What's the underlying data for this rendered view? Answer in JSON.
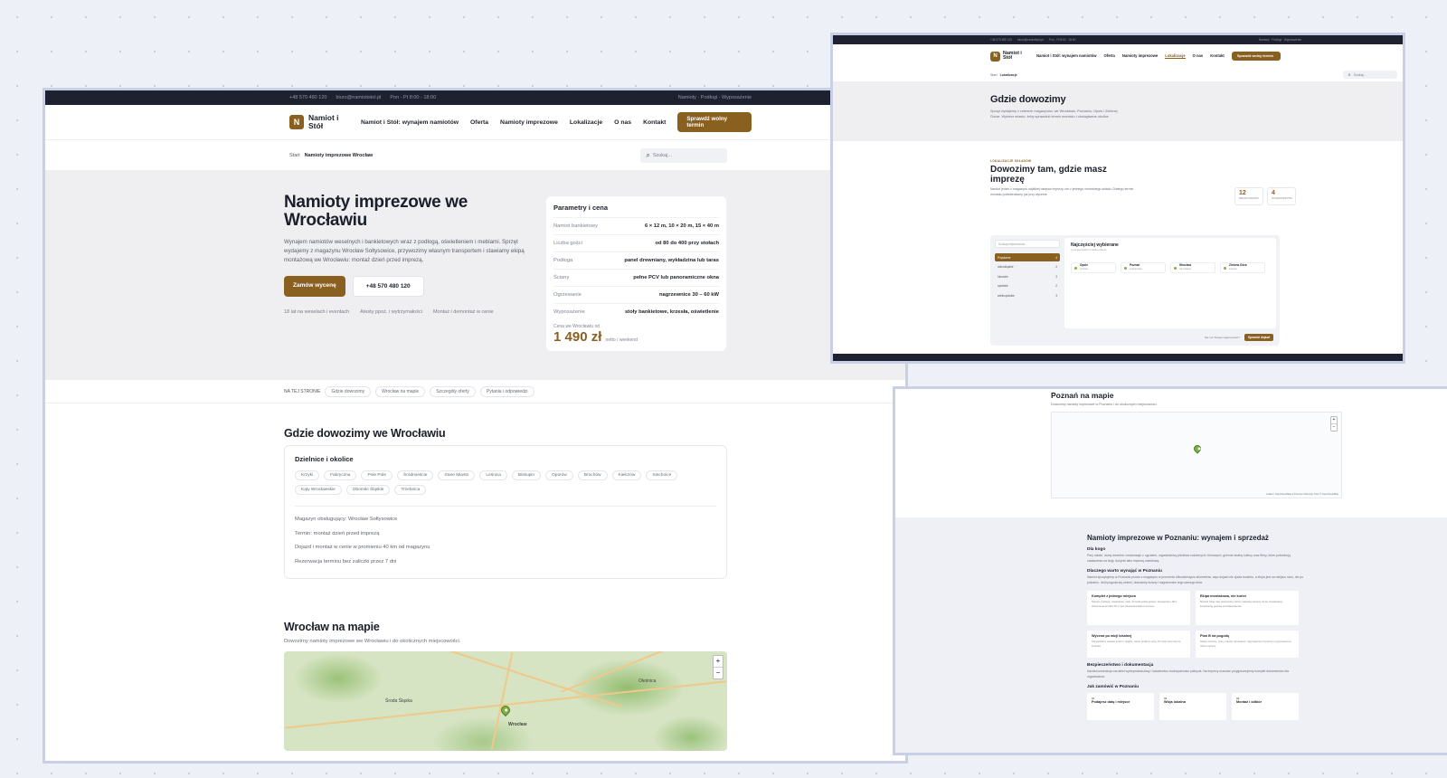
{
  "main": {
    "topbar": {
      "phone": "+48 570 480 120",
      "email": "biuro@namiotistol.pl",
      "hours": "Pon - Pt 8:00 - 18:00",
      "right": "Namioty · Podłogi · Wyposażenie"
    },
    "nav": {
      "logo_letter": "N",
      "logo_text": "Namiot i Stół",
      "links": [
        "Namiot i Stół: wynajem namiotów",
        "Oferta",
        "Namioty imprezowe",
        "Lokalizacje",
        "O nas",
        "Kontakt"
      ],
      "cta": "Sprawdź wolny termin"
    },
    "breadcrumb": {
      "root": "Start",
      "current": "Namioty imprezowe Wrocław"
    },
    "search": {
      "placeholder": "Szukaj..."
    },
    "hero": {
      "title": "Namioty imprezowe we Wrocławiu",
      "description": "Wynajem namiotów weselnych i bankietowych wraz z podłogą, oświetleniem i meblami. Sprzęt wydajemy z magazynu Wrocław Sołtysowice, przywozimy własnym transportem i stawiamy ekipą montażową we Wrocławiu: montaż dzień przed imprezą.",
      "btn_primary": "Zamów wycenę",
      "btn_phone": "+48 570 480 120",
      "features": [
        "18 lat na weselach i eventach",
        "Atesty ppoż. i wytrzymałości",
        "Montaż i demontaż w cenie"
      ]
    },
    "params": {
      "title": "Parametry i cena",
      "rows": [
        {
          "k": "Namiot bankietowy",
          "v": "6 × 12 m, 10 × 20 m, 15 × 40 m"
        },
        {
          "k": "Liczba gości",
          "v": "od 80 do 400 przy stołach"
        },
        {
          "k": "Podłoga",
          "v": "panel drewniany, wykładzina lub taras"
        },
        {
          "k": "Ściany",
          "v": "pełne PCV lub panoramiczne okna"
        },
        {
          "k": "Ogrzewanie",
          "v": "nagrzewnice 30 – 60 kW"
        },
        {
          "k": "Wyposażenie",
          "v": "stoły bankietowe, krzesła, oświetlenie"
        }
      ],
      "price_label": "Cena we Wrocławiu od",
      "price": "1 490 zł",
      "price_note": "netto / weekend"
    },
    "anchors": {
      "label": "NA TEJ STRONIE",
      "items": [
        "Gdzie dowozimy",
        "Wrocław na mapie",
        "Szczegóły oferty",
        "Pytania i odpowiedzi"
      ]
    },
    "delivery": {
      "title": "Gdzie dowozimy we Wrocławiu",
      "box_title": "Dzielnice i okolice",
      "districts": [
        "Krzyki",
        "Fabryczna",
        "Pole Pole",
        "Śródmieście",
        "Stare Miasto",
        "Leśnica",
        "Biskupin",
        "Oporów",
        "Brochów",
        "Kiełczów",
        "Siechnice",
        "Kąty Wrocławskie",
        "Oborniki Śląskie",
        "Trzebnica"
      ],
      "info": [
        "Magazyn obsługujący: Wrocław Sołtysowice",
        "Termin: montaż dzień przed imprezą",
        "Dojazd i montaż w cenie w promieniu 40 km od magazynu",
        "Rezerwacja terminu bez zaliczki przez 7 dni"
      ]
    },
    "map": {
      "title": "Wrocław na mapie",
      "subtitle": "Dowozimy namioty imprezowe we Wrocławiu i do okolicznych miejscowości.",
      "cities": [
        "Środa Śląska",
        "Wrocław",
        "Oleśnica"
      ],
      "zoom_in": "+",
      "zoom_out": "−"
    }
  },
  "locations": {
    "topbar": {
      "phone": "+48 570 480 120",
      "email": "biuro@namiotistol.pl",
      "hours": "Pon - Pt 8:00 - 18:00",
      "right": "Namioty · Podłogi · Wyposażenie"
    },
    "nav": {
      "logo_letter": "N",
      "logo_text": "Namiot i Stół",
      "links": [
        "Namiot i Stół: wynajem namiotów",
        "Oferta",
        "Namioty imprezowe",
        "Lokalizacje",
        "O nas",
        "Kontakt"
      ],
      "cta": "Sprawdź wolny termin"
    },
    "breadcrumb": {
      "root": "Start",
      "current": "Lokalizacje"
    },
    "search": {
      "placeholder": "Szukaj..."
    },
    "hero": {
      "title": "Gdzie dowozimy",
      "description": "Sprzęt wydajemy z czterech magazynów: we Wrocławiu, Poznaniu, Opolu i Zielonej Górze. Wybierz miasto, żeby sprawdzić termin montażu i obsługiwane okolice."
    },
    "section": {
      "kicker": "LOKALIZACJE SKŁADÓW",
      "title": "Dowozimy tam, gdzie masz imprezę",
      "description": "Namiot jedzie z magazynu najbliżej miejsca imprezy, nie z jednego centralnego składu. Dlatego termin montażu potwierdzamy już przy wycenie.",
      "stats": [
        {
          "n": "12",
          "l": "MIEJSCOWOŚCI"
        },
        {
          "n": "4",
          "l": "WOJEWÓDZTWA"
        }
      ]
    },
    "panel": {
      "search": "Szukaj miejscowości...",
      "regions": [
        {
          "name": "Popularne",
          "count": "4"
        },
        {
          "name": "dolnośląskie",
          "count": "4"
        },
        {
          "name": "lubuskie",
          "count": "3"
        },
        {
          "name": "opolskie",
          "count": "2"
        },
        {
          "name": "wielkopolskie",
          "count": "3"
        }
      ],
      "main_title": "Najczęściej wybierane",
      "main_sub": "4 miejscowości w naszej ofercie",
      "cities": [
        {
          "name": "Opole",
          "region": "opolskie"
        },
        {
          "name": "Poznań",
          "region": "wielkopolskie"
        },
        {
          "name": "Wrocław",
          "region": "dolnośląskie"
        },
        {
          "name": "Zielona Góra",
          "region": "lubuskie"
        }
      ],
      "foot_text": "Nie ma Twojej miejscowości?",
      "foot_btn": "Sprawdź dojazd"
    }
  },
  "poznan": {
    "map": {
      "title": "Poznań na mapie",
      "subtitle": "Dowozimy namioty imprezowe w Poznaniu i do okolicznych miejscowości.",
      "attribution": "Leaflet | OpenStreetMap ♥ Premium Namioty, Tiles © OpenStreetMap",
      "zoom_in": "+",
      "zoom_out": "−"
    },
    "content": {
      "title": "Namioty imprezowe w Poznaniu: wynajem i sprzedaż",
      "h_who": "Dla kogo",
      "p_who": "Pary młode, domy weselne i restauracje z ogrodem, organizatorzy pikników rodzinnych i firmowych, gminne służby kultury oraz firmy, które potrzebują zadaszenia na targi, dożynki albo imprezę osiedlową.",
      "h_why": "Dlaczego warto wynająć w Poznaniu",
      "p_why": "Namiot sprzętujemy w Poznaniu prosto z magazynu w promieniu kilkudziesięciu kilometrów, więc dojazd nie zjada budżetu, a ekipa jest na miejscu rano, nie po południu. Jeśli pogoda się zmieni, dowozimy ściany i nagrzewnice tego samego dnia.",
      "cards": [
        {
          "t": "Komplet z jednego miejsca",
          "d": "Namiot, podłoga, oświetlenie, stoły i krzesła jedzie jednym transportem. Bez dzwonienia do kilku firm i bez pilnowania kilku terminów."
        },
        {
          "t": "Ekipa montażowa, nie kurier",
          "d": "Montaż robią nasi pracownicy, którzy stawiają namioty od lat. Zostawiamy konstrukcję gotową pod dekoratorów."
        },
        {
          "t": "Wycena po wizji lokalnej",
          "d": "Sprawdzamy spadek terenu i dojazd, zanim podamy cenę. Po wizji cena się nie zmienia."
        },
        {
          "t": "Plan B na pogodę",
          "d": "Ściany boczne, rynny między namiotami i nagrzewnice trzymamy w gotowości na dzień imprezy."
        }
      ],
      "h_safety": "Bezpieczeństwo i dokumentacja",
      "p_safety": "Każda konstrukcja ma atest wytrzymałościowy i świadectwo trudnopalności pokrycia. Na imprezy masowe przygotowujemy komplet dokumentów dla organizatora.",
      "h_order": "Jak zamówić w Poznaniu",
      "steps": [
        {
          "n": "01",
          "t": "Podajesz datę i miejsce"
        },
        {
          "n": "02",
          "t": "Wizja lokalna"
        },
        {
          "n": "03",
          "t": "Montaż i odbiór"
        }
      ]
    }
  }
}
